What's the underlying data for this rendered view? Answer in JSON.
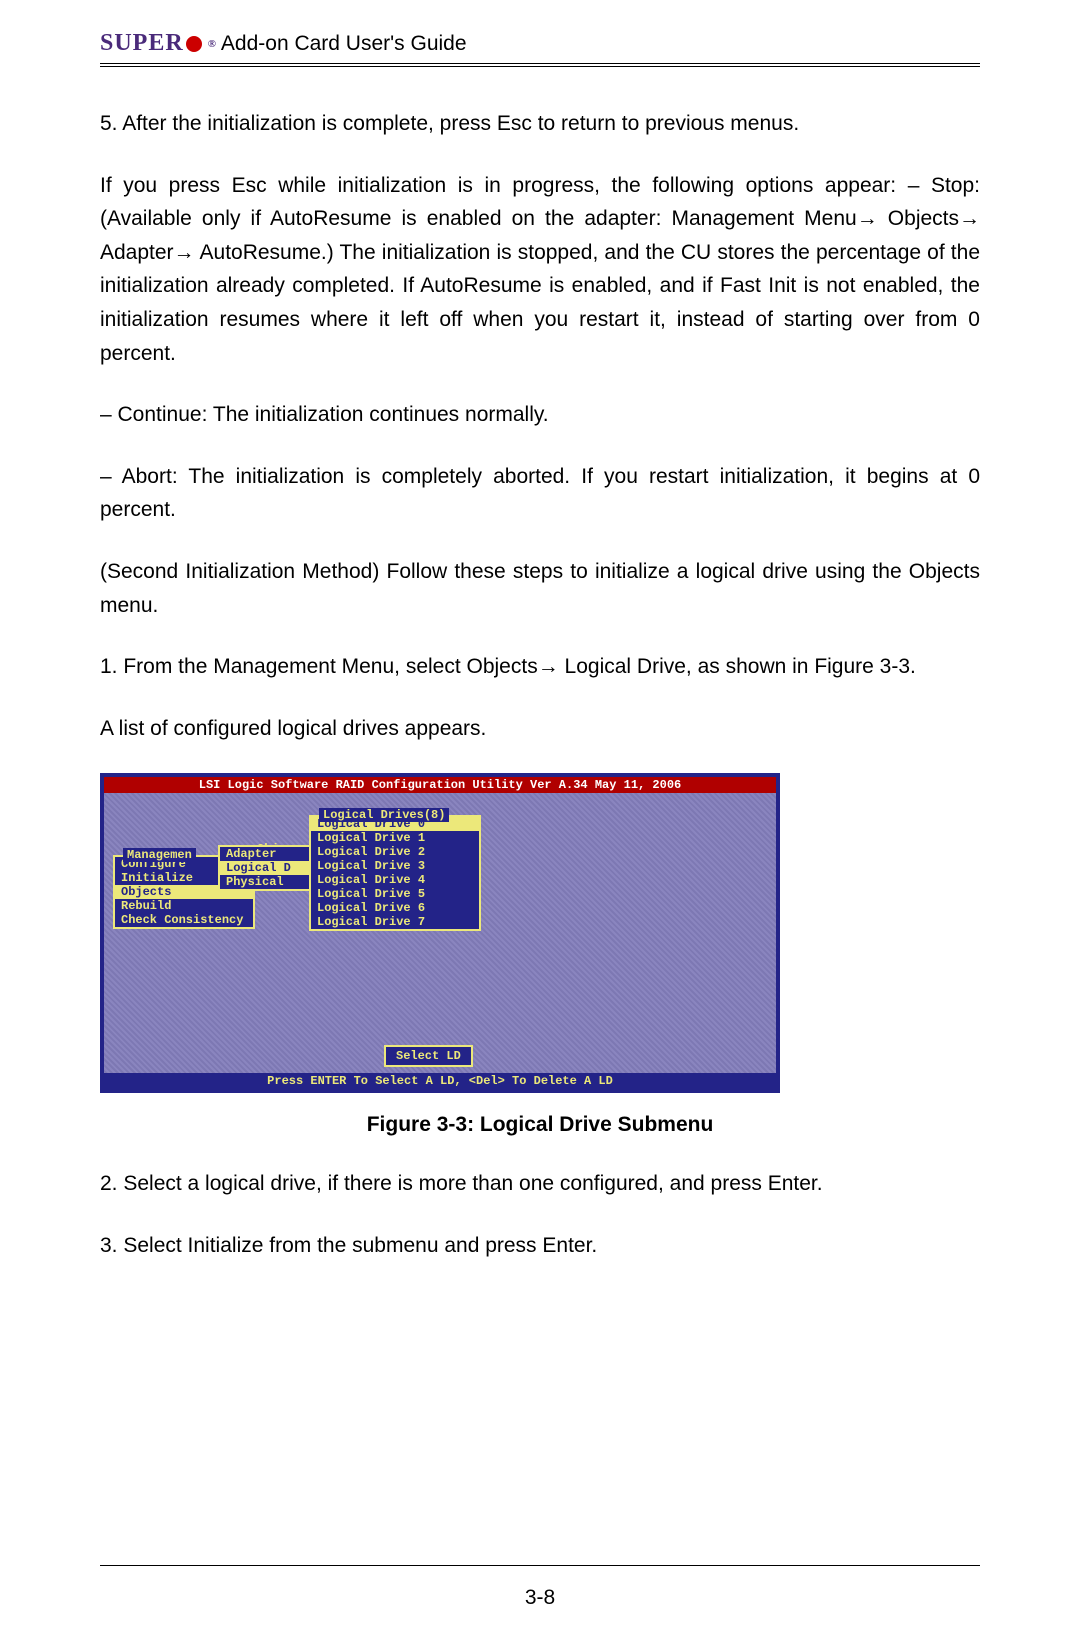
{
  "header": {
    "logo_text": "SUPER",
    "title": "Add-on Card User's Guide"
  },
  "paragraphs": {
    "p1": "5. After the initialization is complete, press Esc to return to previous menus.",
    "p2": "If you press Esc while initialization is in progress, the following options appear: – Stop: (Available only if AutoResume is enabled on the adapter: Management Menu→ Objects→ Adapter→ AutoResume.) The initialization is stopped, and the CU stores the percentage of the initialization already completed. If AutoResume is enabled, and if Fast Init is not enabled, the initialization resumes where it left off when you restart it, instead of starting over from 0 percent.",
    "p3": "– Continue: The initialization continues normally.",
    "p4": "– Abort: The initialization is completely aborted. If you restart initialization, it begins at 0 percent.",
    "p5": "(Second Initialization Method) Follow these steps to initialize a logical drive using the Objects menu.",
    "p6": "1. From the Management Menu, select Objects→ Logical Drive, as shown in Figure 3-3.",
    "p7": "A list of configured logical drives appears.",
    "p8": "2. Select a logical drive, if there is more than one configured, and press Enter.",
    "p9": "3. Select Initialize from the submenu and press Enter."
  },
  "screenshot": {
    "title": "LSI Logic Software RAID Configuration Utility Ver A.34 May 11, 2006",
    "mgmt_title": "Managemen",
    "mgmt_items": [
      "Configure",
      "Initialize",
      "Objects",
      "Rebuild",
      "Check Consistency"
    ],
    "mgmt_selected": "Objects",
    "obj_label": "Obj",
    "obj_items": [
      "Adapter",
      "Logical D",
      "Physical"
    ],
    "obj_selected": "Logical D",
    "ld_title": "Logical Drives(8)",
    "ld_items": [
      "Logical Drive 0",
      "Logical Drive 1",
      "Logical Drive 2",
      "Logical Drive 3",
      "Logical Drive 4",
      "Logical Drive 5",
      "Logical Drive 6",
      "Logical Drive 7"
    ],
    "ld_selected": "Logical Drive 0",
    "select_box": "Select LD",
    "footer": "Press ENTER To Select A LD, <Del> To Delete A LD"
  },
  "figure_caption": "Figure 3-3: Logical Drive Submenu",
  "page_number": "3-8"
}
